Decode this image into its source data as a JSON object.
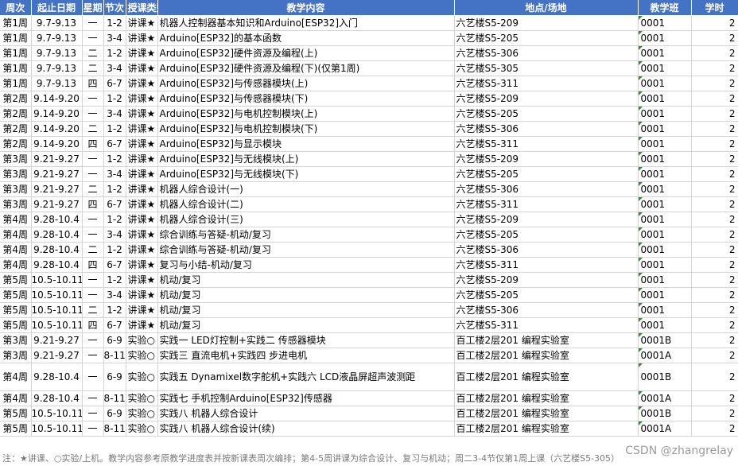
{
  "headers": {
    "week": "周次",
    "dates": "起止日期",
    "weekday": "星期",
    "period": "节次",
    "type": "授课类型",
    "content": "教学内容",
    "place": "地点/场地",
    "class": "教学班",
    "hours": "学时"
  },
  "rows": [
    {
      "week": "第1周",
      "dates": "9.7-9.13",
      "weekday": "一",
      "period": "1-2",
      "type": "讲课★",
      "content": "机器人控制器基本知识和Arduino[ESP32]入门",
      "place": "六艺楼S5-209",
      "cls": "0001",
      "hours": "2"
    },
    {
      "week": "第1周",
      "dates": "9.7-9.13",
      "weekday": "一",
      "period": "3-4",
      "type": "讲课★",
      "content": "Arduino[ESP32]的基本函数",
      "place": "六艺楼S5-205",
      "cls": "0001",
      "hours": "2"
    },
    {
      "week": "第1周",
      "dates": "9.7-9.13",
      "weekday": "二",
      "period": "1-2",
      "type": "讲课★",
      "content": "Arduino[ESP32]硬件资源及编程(上)",
      "place": "六艺楼S5-306",
      "cls": "0001",
      "hours": "2"
    },
    {
      "week": "第1周",
      "dates": "9.7-9.13",
      "weekday": "二",
      "period": "3-4",
      "type": "讲课★",
      "content": "Arduino[ESP32]硬件资源及编程(下)(仅第1周)",
      "place": "六艺楼S5-305",
      "cls": "0001",
      "hours": "2"
    },
    {
      "week": "第1周",
      "dates": "9.7-9.13",
      "weekday": "四",
      "period": "6-7",
      "type": "讲课★",
      "content": "Arduino[ESP32]与传感器模块(上)",
      "place": "六艺楼S5-311",
      "cls": "0001",
      "hours": "2"
    },
    {
      "week": "第2周",
      "dates": "9.14-9.20",
      "weekday": "一",
      "period": "1-2",
      "type": "讲课★",
      "content": "Arduino[ESP32]与传感器模块(下)",
      "place": "六艺楼S5-209",
      "cls": "0001",
      "hours": "2"
    },
    {
      "week": "第2周",
      "dates": "9.14-9.20",
      "weekday": "一",
      "period": "3-4",
      "type": "讲课★",
      "content": "Arduino[ESP32]与电机控制模块(上)",
      "place": "六艺楼S5-205",
      "cls": "0001",
      "hours": "2"
    },
    {
      "week": "第2周",
      "dates": "9.14-9.20",
      "weekday": "二",
      "period": "1-2",
      "type": "讲课★",
      "content": "Arduino[ESP32]与电机控制模块(下)",
      "place": "六艺楼S5-306",
      "cls": "0001",
      "hours": "2"
    },
    {
      "week": "第2周",
      "dates": "9.14-9.20",
      "weekday": "四",
      "period": "6-7",
      "type": "讲课★",
      "content": "Arduino[ESP32]与显示模块",
      "place": "六艺楼S5-311",
      "cls": "0001",
      "hours": "2"
    },
    {
      "week": "第3周",
      "dates": "9.21-9.27",
      "weekday": "一",
      "period": "1-2",
      "type": "讲课★",
      "content": "Arduino[ESP32]与无线模块(上)",
      "place": "六艺楼S5-209",
      "cls": "0001",
      "hours": "2"
    },
    {
      "week": "第3周",
      "dates": "9.21-9.27",
      "weekday": "一",
      "period": "3-4",
      "type": "讲课★",
      "content": "Arduino[ESP32]与无线模块(下)",
      "place": "六艺楼S5-205",
      "cls": "0001",
      "hours": "2"
    },
    {
      "week": "第3周",
      "dates": "9.21-9.27",
      "weekday": "二",
      "period": "1-2",
      "type": "讲课★",
      "content": "机器人综合设计(一)",
      "place": "六艺楼S5-306",
      "cls": "0001",
      "hours": "2"
    },
    {
      "week": "第3周",
      "dates": "9.21-9.27",
      "weekday": "四",
      "period": "6-7",
      "type": "讲课★",
      "content": "机器人综合设计(二)",
      "place": "六艺楼S5-311",
      "cls": "0001",
      "hours": "2"
    },
    {
      "week": "第4周",
      "dates": "9.28-10.4",
      "weekday": "一",
      "period": "1-2",
      "type": "讲课★",
      "content": "机器人综合设计(三)",
      "place": "六艺楼S5-209",
      "cls": "0001",
      "hours": "2"
    },
    {
      "week": "第4周",
      "dates": "9.28-10.4",
      "weekday": "一",
      "period": "3-4",
      "type": "讲课★",
      "content": "综合训练与答疑-机动/复习",
      "place": "六艺楼S5-205",
      "cls": "0001",
      "hours": "2"
    },
    {
      "week": "第4周",
      "dates": "9.28-10.4",
      "weekday": "二",
      "period": "1-2",
      "type": "讲课★",
      "content": "综合训练与答疑-机动/复习",
      "place": "六艺楼S5-306",
      "cls": "0001",
      "hours": "2"
    },
    {
      "week": "第4周",
      "dates": "9.28-10.4",
      "weekday": "四",
      "period": "6-7",
      "type": "讲课★",
      "content": "复习与小结-机动/复习",
      "place": "六艺楼S5-311",
      "cls": "0001",
      "hours": "2"
    },
    {
      "week": "第5周",
      "dates": "10.5-10.11",
      "weekday": "一",
      "period": "1-2",
      "type": "讲课★",
      "content": "机动/复习",
      "place": "六艺楼S5-209",
      "cls": "0001",
      "hours": "2"
    },
    {
      "week": "第5周",
      "dates": "10.5-10.11",
      "weekday": "一",
      "period": "3-4",
      "type": "讲课★",
      "content": "机动/复习",
      "place": "六艺楼S5-205",
      "cls": "0001",
      "hours": "2"
    },
    {
      "week": "第5周",
      "dates": "10.5-10.11",
      "weekday": "二",
      "period": "1-2",
      "type": "讲课★",
      "content": "机动/复习",
      "place": "六艺楼S5-306",
      "cls": "0001",
      "hours": "2"
    },
    {
      "week": "第5周",
      "dates": "10.5-10.11",
      "weekday": "四",
      "period": "6-7",
      "type": "讲课★",
      "content": "机动/复习",
      "place": "六艺楼S5-311",
      "cls": "0001",
      "hours": "2"
    },
    {
      "week": "第3周",
      "dates": "9.21-9.27",
      "weekday": "一",
      "period": "6-9",
      "type": "实验○",
      "content": "实践一 LED灯控制+实践二 传感器模块",
      "place": "百工楼2层201 编程实验室",
      "cls": "0001B",
      "hours": "2"
    },
    {
      "week": "第3周",
      "dates": "9.21-9.27",
      "weekday": "一",
      "period": "8-11",
      "type": "实验○",
      "content": "实践三 直流电机+实践四 步进电机",
      "place": "百工楼2层201 编程实验室",
      "cls": "0001A",
      "hours": "2"
    },
    {
      "week": "第4周",
      "dates": "9.28-10.4",
      "weekday": "一",
      "period": "6-9",
      "type": "实验○",
      "content": "实践五 Dynamixel数字舵机+实践六 LCD液晶屏超声波测距",
      "place": "百工楼2层201 编程实验室",
      "cls": "0001B",
      "hours": "2",
      "tall": true
    },
    {
      "week": "第4周",
      "dates": "9.28-10.4",
      "weekday": "一",
      "period": "8-11",
      "type": "实验○",
      "content": "实践七 手机控制Arduino[ESP32]传感器",
      "place": "百工楼2层201 编程实验室",
      "cls": "0001A",
      "hours": "2"
    },
    {
      "week": "第5周",
      "dates": "10.5-10.11",
      "weekday": "一",
      "period": "6-9",
      "type": "实验○",
      "content": "实践八 机器人综合设计",
      "place": "百工楼2层201 编程实验室",
      "cls": "0001B",
      "hours": "2"
    },
    {
      "week": "第5周",
      "dates": "10.5-10.11",
      "weekday": "一",
      "period": "8-11",
      "type": "实验○",
      "content": "实践八 机器人综合设计(续)",
      "place": "百工楼2层201 编程实验室",
      "cls": "0001A",
      "hours": "2"
    }
  ],
  "footer": "注：★讲课、○实验/上机。教学内容参考原教学进度表并按新课表周次编排；第4-5周讲课为综合设计、复习与机动；周二3-4节仅第1周上课（六艺楼S5-305）",
  "watermark": "CSDN @zhangrelay"
}
